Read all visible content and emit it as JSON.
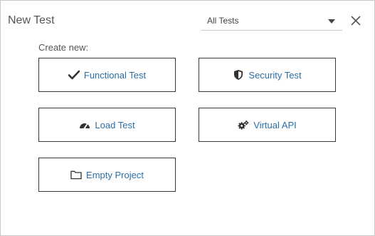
{
  "dialog": {
    "title": "New Test",
    "filter": {
      "selected": "All Tests"
    },
    "section_label": "Create new:"
  },
  "tiles": [
    {
      "label": "Functional Test",
      "icon": "checkmark-icon"
    },
    {
      "label": "Security Test",
      "icon": "shield-icon"
    },
    {
      "label": "Load Test",
      "icon": "speedometer-icon"
    },
    {
      "label": "Virtual API",
      "icon": "gears-icon"
    },
    {
      "label": "Empty Project",
      "icon": "folder-icon"
    }
  ],
  "colors": {
    "link": "#2a6fa8",
    "icon": "#333333",
    "tile_border": "#3a3a3a",
    "dialog_border": "#c8c8c8"
  }
}
